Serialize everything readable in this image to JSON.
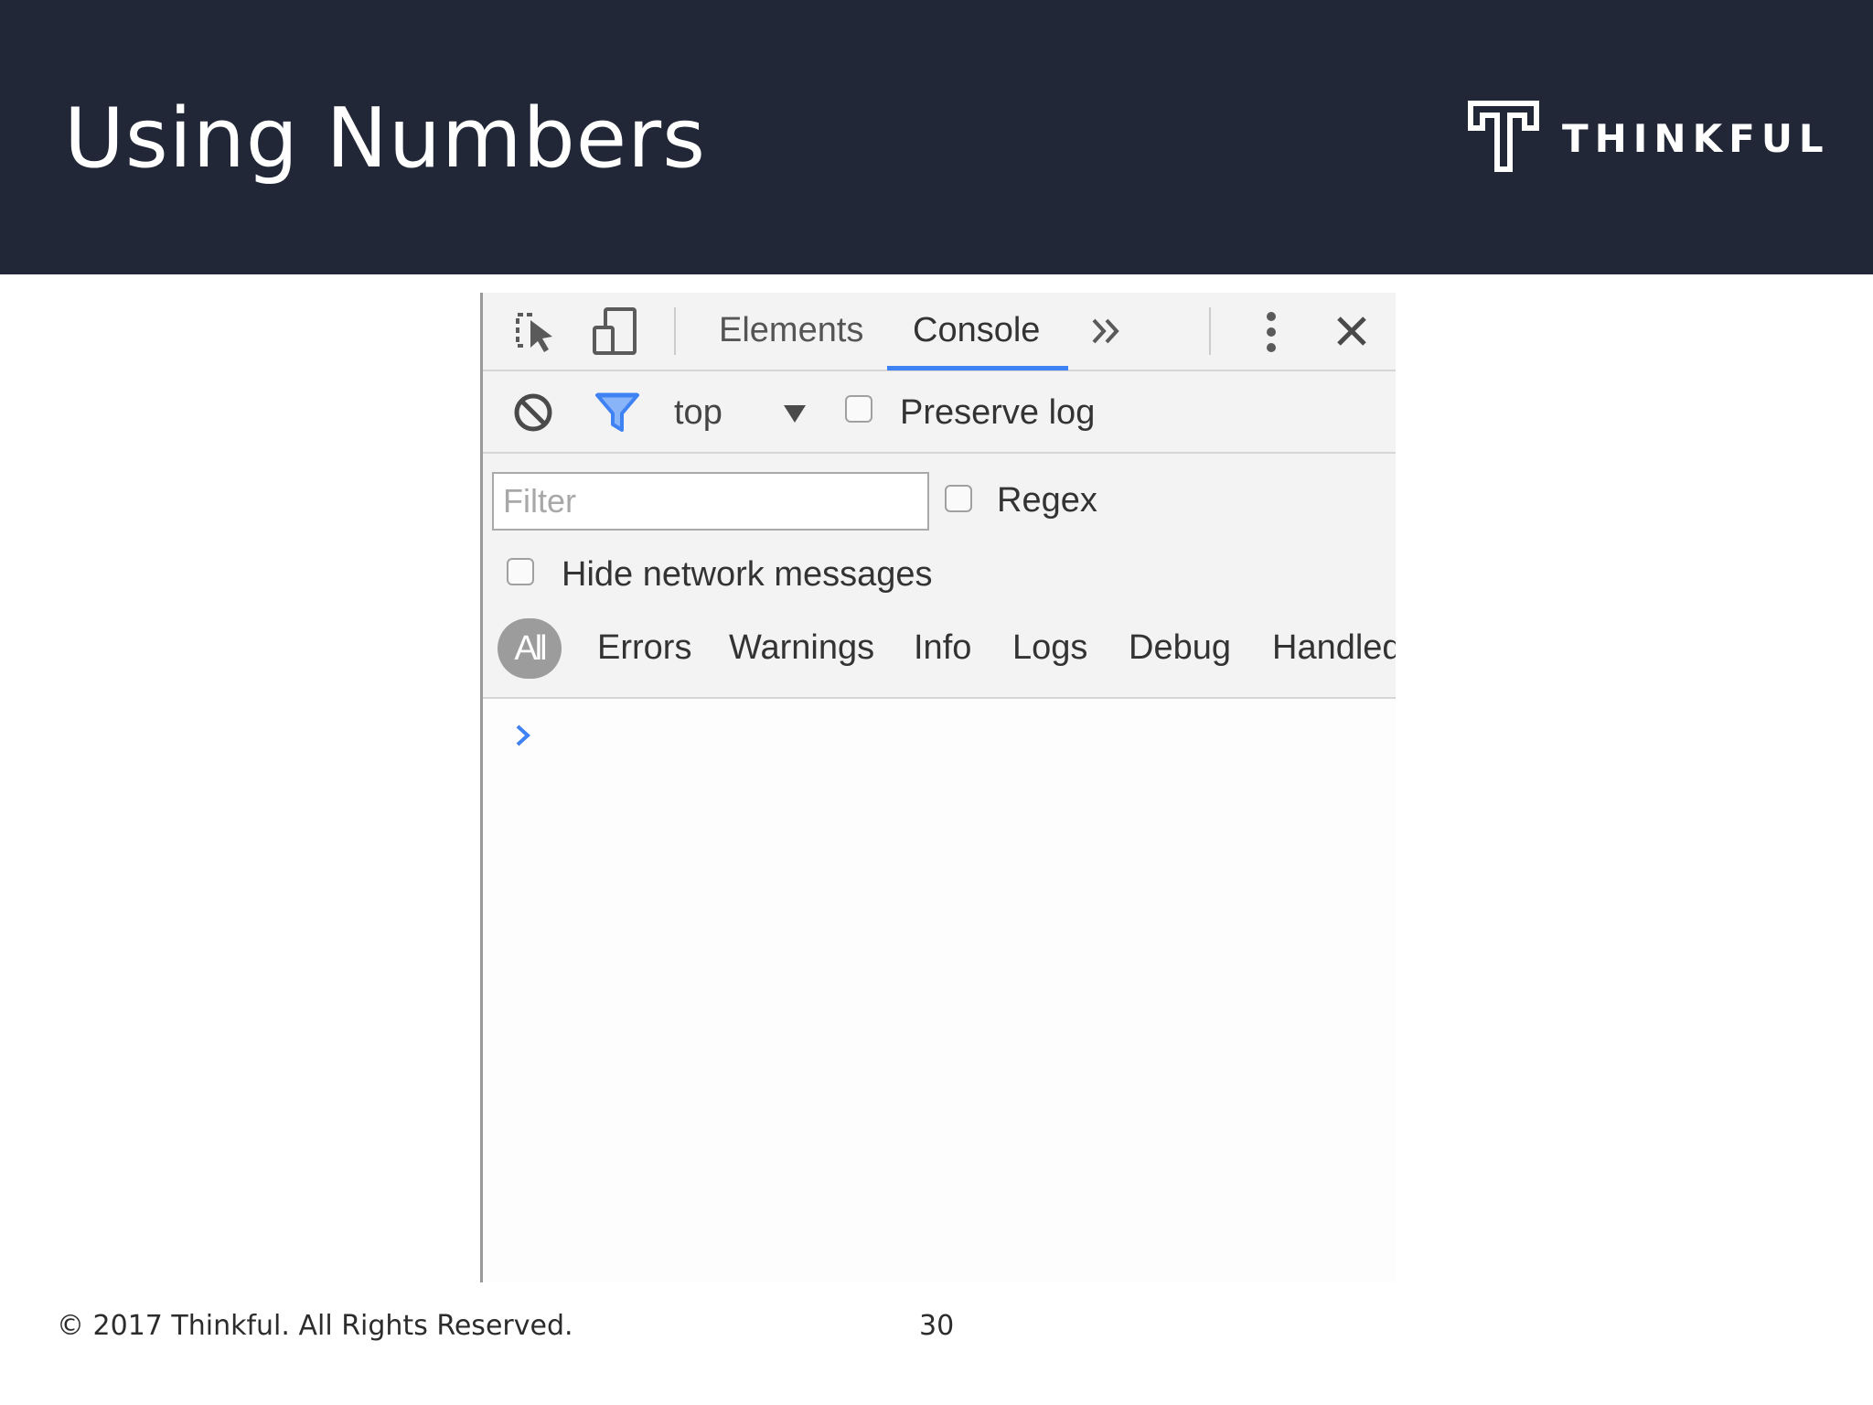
{
  "slide": {
    "title": "Using Numbers",
    "brand": "THINKFUL",
    "footer_copyright": "© 2017 Thinkful. All Rights Reserved.",
    "page_number": "30",
    "header_color": "#212737"
  },
  "devtools": {
    "toolbar_icons": [
      "inspect-element-icon",
      "device-toolbar-icon",
      "more-tabs-icon",
      "kebab-menu-icon",
      "close-icon"
    ],
    "tabs": [
      {
        "label": "Elements",
        "active": false
      },
      {
        "label": "Console",
        "active": true
      }
    ],
    "active_tab_color": "#3f82f4",
    "console_toolbar": {
      "context": "top",
      "preserve_log_label": "Preserve log",
      "preserve_log_checked": false
    },
    "filter": {
      "placeholder": "Filter",
      "value": "",
      "regex_label": "Regex",
      "regex_checked": false,
      "hide_network_label": "Hide network messages",
      "hide_network_checked": false
    },
    "levels": [
      {
        "label": "All",
        "selected": true
      },
      {
        "label": "Errors"
      },
      {
        "label": "Warnings"
      },
      {
        "label": "Info"
      },
      {
        "label": "Logs"
      },
      {
        "label": "Debug"
      },
      {
        "label": "Handled"
      }
    ],
    "prompt_color": "#3f82f4"
  }
}
